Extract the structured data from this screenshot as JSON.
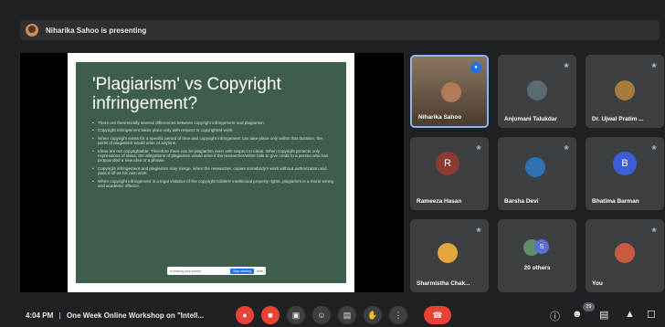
{
  "presenter_bar": {
    "text": "Niharika Sahoo is presenting"
  },
  "slide": {
    "title": "'Plagiarism' vs Copyright infringement?",
    "bullets": [
      "There are theoretically several differences between copyright infringement and plagiarism.",
      "Copyright infringement takes place only with respect to copyrighted work.",
      "When copyright exists for a specific period of time and copyright infringement can take place only within that duration, the perils of plagiarism would arise at anytime.",
      "Ideas are not copyrightable. Therefore there can be plagiarism even with respect to ideas. When copyright protects only expressions of ideas, the allegations of plagiarism would arise if the researcher/writer fails to give credit to a person who has propounded a new idea or a phrase.",
      "Copyright infringement and plagiarism may merge, when the researcher, copies somebody's work without authorization and pass it off as his own work.",
      "When copyright infringement is a legal violation of the copyright holders' intellectual property rights, plagiarism is a moral wrong and academic offence."
    ],
    "toast_text": "is sharing your screen",
    "toast_button": "Stop sharing",
    "toast_hide": "Hide"
  },
  "participants": [
    {
      "name": "Niharika Sahoo"
    },
    {
      "name": "Anjumani Talukdar"
    },
    {
      "name": "Dr. Ujwal Pratim ..."
    },
    {
      "name": "Rameeza Hasan",
      "initial": "R"
    },
    {
      "name": "Barsha Devi"
    },
    {
      "name": "Bhatima Barman",
      "initial": "B"
    },
    {
      "name": "Sharmistha Chak..."
    },
    {
      "name": "20 others"
    },
    {
      "name": "You"
    }
  ],
  "bottom": {
    "time": "4:04 PM",
    "separator": "|",
    "meeting_title": "One Week Online Workshop on \"Intell...",
    "participant_count": "29"
  },
  "colors": {
    "background": "#202124",
    "tile": "#3c4043",
    "slide_green": "#3f5d4c",
    "danger": "#ea4335",
    "accent": "#1a73e8"
  }
}
